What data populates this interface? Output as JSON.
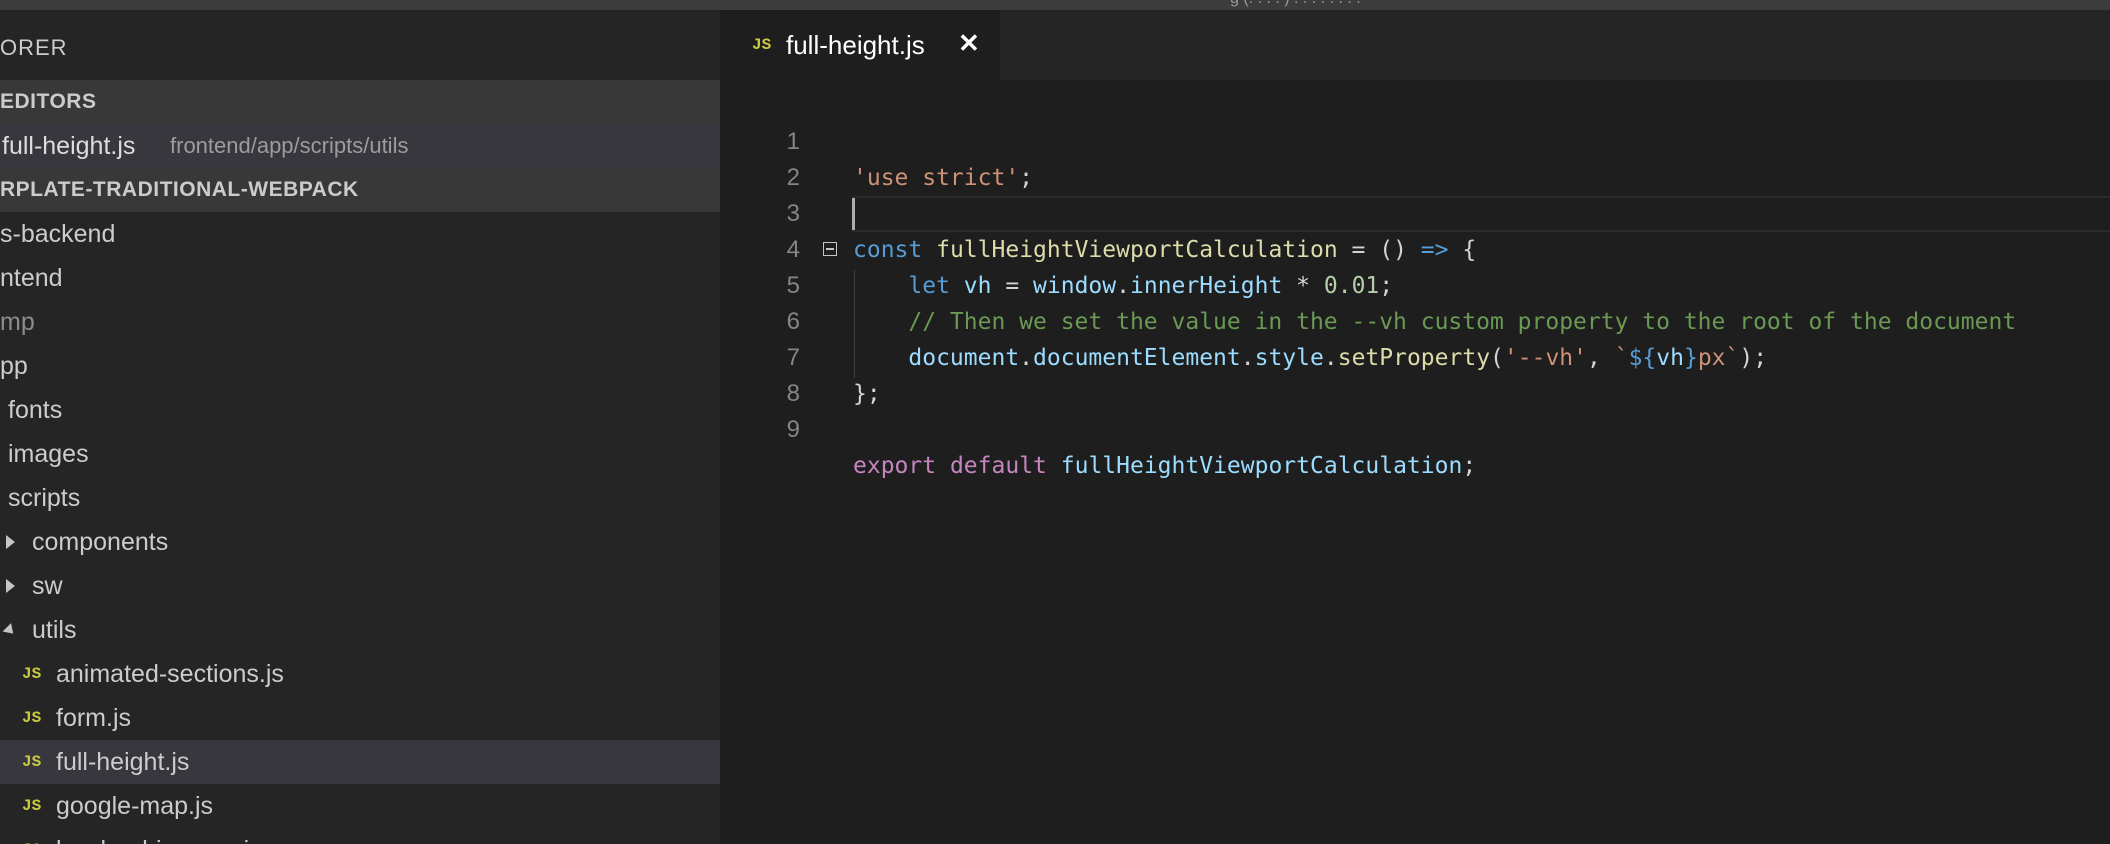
{
  "window": {
    "title_fragment": "g (. . . . ) . . . . . . . ."
  },
  "sidebar": {
    "title": "ORER",
    "open_editors_label": "EDITORS",
    "open_editor": {
      "name": "full-height.js",
      "path": "frontend/app/scripts/utils"
    },
    "project_label": "RPLATE-TRADITIONAL-WEBPACK",
    "tree": [
      {
        "label": "s-backend"
      },
      {
        "label": "ntend"
      },
      {
        "label": "mp"
      },
      {
        "label": "pp"
      },
      {
        "label": "fonts"
      },
      {
        "label": "images"
      },
      {
        "label": "scripts"
      },
      {
        "label": "components"
      },
      {
        "label": "sw"
      },
      {
        "label": "utils"
      },
      {
        "label": "animated-sections.js"
      },
      {
        "label": "form.js"
      },
      {
        "label": "full-height.js"
      },
      {
        "label": "google-map.js"
      },
      {
        "label": "lazyload-images.js"
      }
    ],
    "js_badge": "JS"
  },
  "tab": {
    "label": "full-height.js",
    "close": "✕",
    "badge": "JS"
  },
  "editor": {
    "line_numbers": [
      "1",
      "2",
      "3",
      "4",
      "5",
      "6",
      "7",
      "8",
      "9"
    ],
    "code": {
      "l1": {
        "str": "'use strict'",
        "semi": ";"
      },
      "l3": {
        "kw": "const",
        "name": "fullHeightViewportCalculation",
        "eq": " = () ",
        "arrow": "=>",
        "brace": " {"
      },
      "l4": {
        "kw": "let",
        "var": "vh",
        "eq": " = ",
        "obj": "window",
        "dot": ".",
        "prop": "innerHeight",
        "op": " * ",
        "num": "0.01",
        "semi": ";"
      },
      "l5": {
        "comment": "// Then we set the value in the --vh custom property to the root of the document"
      },
      "l6": {
        "obj1": "document",
        "dot1": ".",
        "obj2": "documentElement",
        "dot2": ".",
        "obj3": "style",
        "dot3": ".",
        "fn": "setProperty",
        "open": "(",
        "arg1": "'--vh'",
        "comma": ", ",
        "tick": "`",
        "tpl_open": "${",
        "tpl_var": "vh",
        "tpl_close": "}",
        "tpl_rest": "px`",
        "close": ");"
      },
      "l7": {
        "text": "};"
      },
      "l9": {
        "kw1": "export",
        "kw2": "default",
        "name": "fullHeightViewportCalculation",
        "semi": ";"
      }
    }
  }
}
